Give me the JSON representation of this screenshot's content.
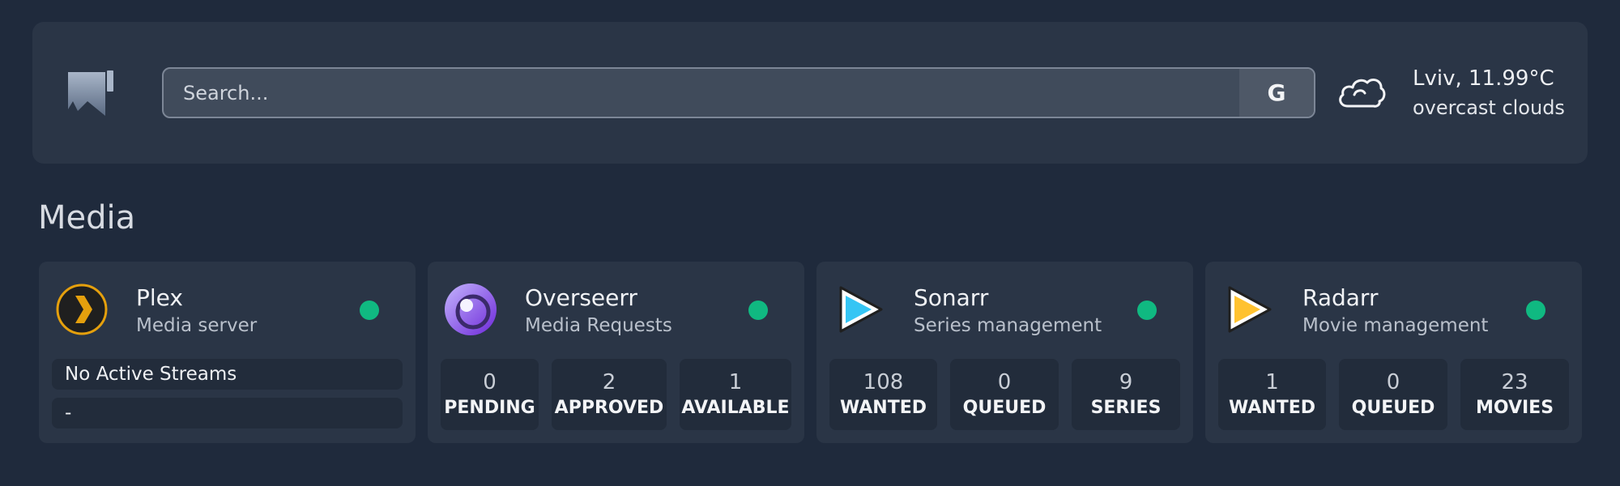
{
  "search": {
    "placeholder": "Search...",
    "engine_label": "G"
  },
  "weather": {
    "location_temp": "Lviv, 11.99°C",
    "description": "overcast clouds",
    "icon": "cloud-icon"
  },
  "section": {
    "title": "Media"
  },
  "colors": {
    "status_online": "#10b981",
    "plex": "#e5a00d",
    "overseerr": "#8b5cf6",
    "sonarr": "#35c5f4",
    "radarr": "#ffc230"
  },
  "cards": [
    {
      "title": "Plex",
      "subtitle": "Media server",
      "icon": "plex-icon",
      "status": "online",
      "streams": [
        "No Active Streams",
        "-"
      ]
    },
    {
      "title": "Overseerr",
      "subtitle": "Media Requests",
      "icon": "overseerr-icon",
      "status": "online",
      "stats": [
        {
          "value": "0",
          "label": "PENDING"
        },
        {
          "value": "2",
          "label": "APPROVED"
        },
        {
          "value": "1",
          "label": "AVAILABLE"
        }
      ]
    },
    {
      "title": "Sonarr",
      "subtitle": "Series management",
      "icon": "sonarr-icon",
      "status": "online",
      "stats": [
        {
          "value": "108",
          "label": "WANTED"
        },
        {
          "value": "0",
          "label": "QUEUED"
        },
        {
          "value": "9",
          "label": "SERIES"
        }
      ]
    },
    {
      "title": "Radarr",
      "subtitle": "Movie management",
      "icon": "radarr-icon",
      "status": "online",
      "stats": [
        {
          "value": "1",
          "label": "WANTED"
        },
        {
          "value": "0",
          "label": "QUEUED"
        },
        {
          "value": "23",
          "label": "MOVIES"
        }
      ]
    }
  ]
}
